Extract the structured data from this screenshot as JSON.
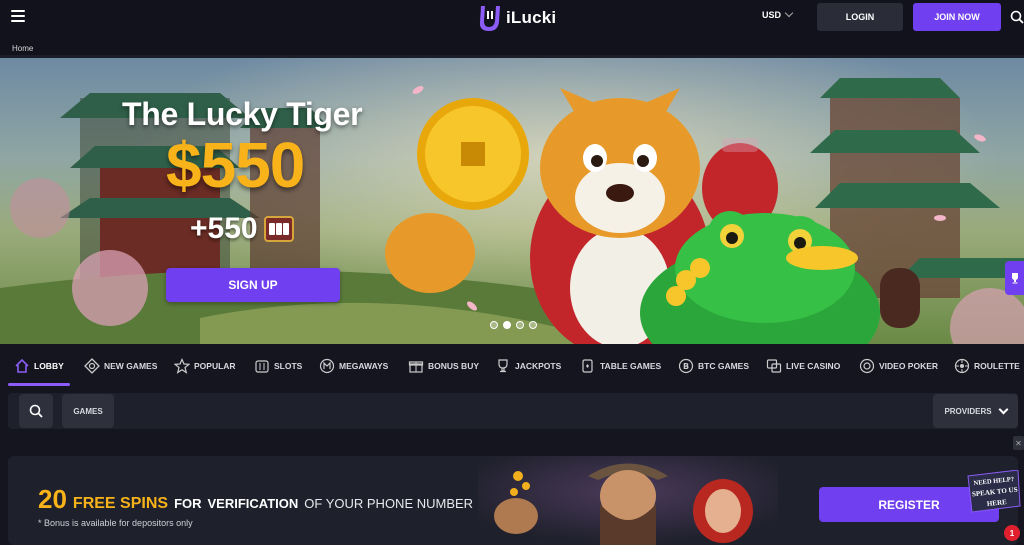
{
  "header": {
    "logo_text": "iLucki",
    "currency": "USD",
    "login_label": "LOGIN",
    "join_label": "JOIN NOW"
  },
  "breadcrumb": {
    "home": "Home"
  },
  "hero": {
    "title": "The Lucky Tiger",
    "amount": "$550",
    "sub": "+550",
    "signup_label": "SIGN UP",
    "slide_count": 4,
    "active_slide": 1
  },
  "categories": [
    {
      "label": "LOBBY",
      "icon": "home-icon"
    },
    {
      "label": "NEW GAMES",
      "icon": "diamond-icon"
    },
    {
      "label": "POPULAR",
      "icon": "star-icon"
    },
    {
      "label": "SLOTS",
      "icon": "slot-machine-icon"
    },
    {
      "label": "MEGAWAYS",
      "icon": "m-circle-icon"
    },
    {
      "label": "BONUS BUY",
      "icon": "gift-icon"
    },
    {
      "label": "JACKPOTS",
      "icon": "trophy-icon"
    },
    {
      "label": "TABLE GAMES",
      "icon": "cards-icon"
    },
    {
      "label": "BTC GAMES",
      "icon": "bitcoin-icon"
    },
    {
      "label": "LIVE CASINO",
      "icon": "live-icon"
    },
    {
      "label": "VIDEO POKER",
      "icon": "chip-icon"
    },
    {
      "label": "ROULETTE",
      "icon": "roulette-icon"
    }
  ],
  "search": {
    "games_label": "GAMES",
    "providers_label": "PROVIDERS"
  },
  "promo": {
    "number": "20",
    "free_spins": "FREE SPINS",
    "for": "FOR",
    "verification": "VERIFICATION",
    "rest": "OF YOUR PHONE NUMBER",
    "note": "* Bonus is available for depositors only",
    "register_label": "REGISTER"
  },
  "help": {
    "line1": "NEED HELP?",
    "line2": "SPEAK TO US",
    "line3": "HERE",
    "notification_count": "1"
  },
  "colors": {
    "accent": "#6f3ff0",
    "gold": "#f8b21a",
    "background": "#14151f"
  }
}
